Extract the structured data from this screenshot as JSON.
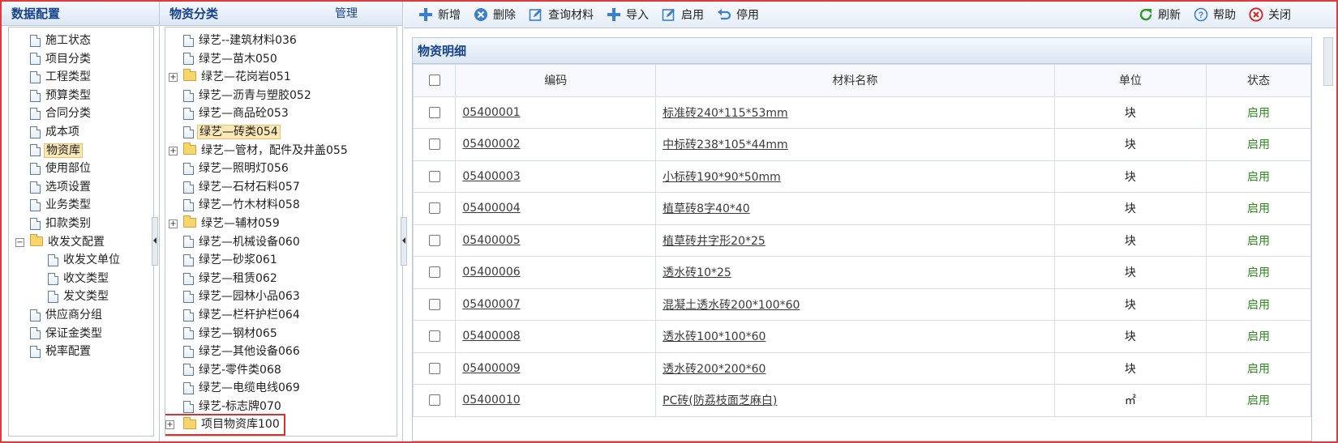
{
  "left_panel": {
    "title": "数据配置",
    "items": [
      {
        "label": "施工状态",
        "type": "doc",
        "level": 1
      },
      {
        "label": "项目分类",
        "type": "doc",
        "level": 1
      },
      {
        "label": "工程类型",
        "type": "doc",
        "level": 1
      },
      {
        "label": "预算类型",
        "type": "doc",
        "level": 1
      },
      {
        "label": "合同分类",
        "type": "doc",
        "level": 1
      },
      {
        "label": "成本项",
        "type": "doc",
        "level": 1
      },
      {
        "label": "物资库",
        "type": "doc",
        "level": 1,
        "selected": true
      },
      {
        "label": "使用部位",
        "type": "doc",
        "level": 1
      },
      {
        "label": "选项设置",
        "type": "doc",
        "level": 1
      },
      {
        "label": "业务类型",
        "type": "doc",
        "level": 1
      },
      {
        "label": "扣款类别",
        "type": "doc",
        "level": 1
      },
      {
        "label": "收发文配置",
        "type": "folder",
        "level": 1,
        "expanded": true
      },
      {
        "label": "收发文单位",
        "type": "doc",
        "level": 2
      },
      {
        "label": "收文类型",
        "type": "doc",
        "level": 2
      },
      {
        "label": "发文类型",
        "type": "doc",
        "level": 2
      },
      {
        "label": "供应商分组",
        "type": "doc",
        "level": 1
      },
      {
        "label": "保证金类型",
        "type": "doc",
        "level": 1
      },
      {
        "label": "税率配置",
        "type": "doc",
        "level": 1
      }
    ]
  },
  "mid_panel": {
    "title": "物资分类",
    "manage_label": "管理",
    "items": [
      {
        "label": "绿艺--建筑材料036",
        "type": "doc"
      },
      {
        "label": "绿艺—苗木050",
        "type": "doc"
      },
      {
        "label": "绿艺—花岗岩051",
        "type": "folder",
        "collapsed": true
      },
      {
        "label": "绿艺—沥青与塑胶052",
        "type": "doc"
      },
      {
        "label": "绿艺—商品砼053",
        "type": "doc"
      },
      {
        "label": "绿艺—砖类054",
        "type": "doc",
        "selected": true
      },
      {
        "label": "绿艺—管材，配件及井盖055",
        "type": "folder",
        "collapsed": true
      },
      {
        "label": "绿艺—照明灯056",
        "type": "doc"
      },
      {
        "label": "绿艺—石材石料057",
        "type": "doc"
      },
      {
        "label": "绿艺—竹木材料058",
        "type": "doc"
      },
      {
        "label": "绿艺—辅材059",
        "type": "folder",
        "collapsed": true
      },
      {
        "label": "绿艺—机械设备060",
        "type": "doc"
      },
      {
        "label": "绿艺—砂浆061",
        "type": "doc"
      },
      {
        "label": "绿艺—租赁062",
        "type": "doc"
      },
      {
        "label": "绿艺—园林小品063",
        "type": "doc"
      },
      {
        "label": "绿艺—栏杆护栏064",
        "type": "doc"
      },
      {
        "label": "绿艺—钢材065",
        "type": "doc"
      },
      {
        "label": "绿艺—其他设备066",
        "type": "doc"
      },
      {
        "label": "绿艺-零件类068",
        "type": "doc"
      },
      {
        "label": "绿艺—电缆电线069",
        "type": "doc"
      },
      {
        "label": "绿艺-标志牌070",
        "type": "doc"
      },
      {
        "label": "项目物资库100",
        "type": "folder",
        "collapsed": true,
        "highlight": true
      }
    ]
  },
  "toolbar": {
    "left": [
      {
        "label": "新增",
        "icon": "plus-icon",
        "color": "#3a7fd0"
      },
      {
        "label": "删除",
        "icon": "delete-circle-icon",
        "color": "#3a7fd0"
      },
      {
        "label": "查询材料",
        "icon": "edit-icon",
        "color": "#3a7fd0"
      },
      {
        "label": "导入",
        "icon": "plus-icon",
        "color": "#3a7fd0"
      },
      {
        "label": "启用",
        "icon": "edit-icon",
        "color": "#3a7fd0"
      },
      {
        "label": "停用",
        "icon": "undo-icon",
        "color": "#3a7fd0"
      }
    ],
    "right": [
      {
        "label": "刷新",
        "icon": "refresh-icon",
        "color": "#2e9a2e"
      },
      {
        "label": "帮助",
        "icon": "help-icon",
        "color": "#3a7fd0"
      },
      {
        "label": "关闭",
        "icon": "close-circle-icon",
        "color": "#d22a2a"
      }
    ]
  },
  "detail": {
    "title": "物资明细",
    "columns": [
      "编码",
      "材料名称",
      "单位",
      "状态"
    ],
    "rows": [
      {
        "code": "05400001",
        "name": "标准砖240*115*53mm",
        "unit": "块",
        "status": "启用"
      },
      {
        "code": "05400002",
        "name": "中标砖238*105*44mm",
        "unit": "块",
        "status": "启用"
      },
      {
        "code": "05400003",
        "name": "小标砖190*90*50mm",
        "unit": "块",
        "status": "启用"
      },
      {
        "code": "05400004",
        "name": "植草砖8字40*40",
        "unit": "块",
        "status": "启用"
      },
      {
        "code": "05400005",
        "name": "植草砖井字形20*25",
        "unit": "块",
        "status": "启用"
      },
      {
        "code": "05400006",
        "name": "透水砖10*25",
        "unit": "块",
        "status": "启用"
      },
      {
        "code": "05400007",
        "name": "混凝土透水砖200*100*60",
        "unit": "块",
        "status": "启用"
      },
      {
        "code": "05400008",
        "name": "透水砖100*100*60",
        "unit": "块",
        "status": "启用"
      },
      {
        "code": "05400009",
        "name": "透水砖200*200*60",
        "unit": "块",
        "status": "启用"
      },
      {
        "code": "05400010",
        "name": "PC砖(防荔枝面芝麻白)",
        "unit": "㎡",
        "status": "启用"
      }
    ]
  }
}
